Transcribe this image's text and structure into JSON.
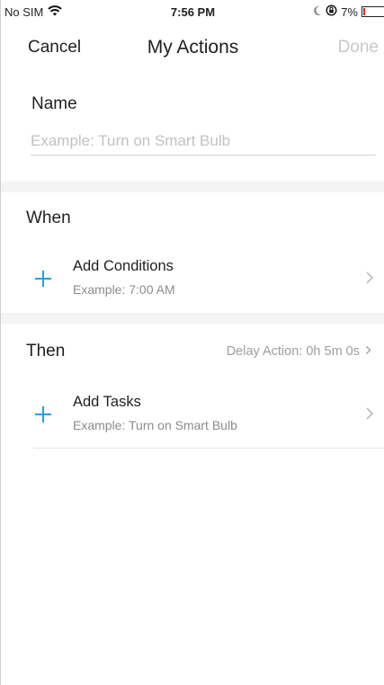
{
  "status_bar": {
    "carrier": "No SIM",
    "time": "7:56 PM",
    "battery": "7%",
    "battery_level_percent": 7,
    "icons": [
      "wifi-icon",
      "moon-icon",
      "rotation-lock-icon",
      "battery-icon"
    ]
  },
  "nav": {
    "cancel": "Cancel",
    "title": "My Actions",
    "done": "Done"
  },
  "name": {
    "label": "Name",
    "placeholder": "Example: Turn on Smart Bulb",
    "value": ""
  },
  "when": {
    "title": "When",
    "row_title": "Add Conditions",
    "row_subtitle": "Example: 7:00 AM"
  },
  "then": {
    "title": "Then",
    "delay": "Delay Action: 0h 5m 0s",
    "row_title": "Add Tasks",
    "row_subtitle": "Example: Turn on Smart Bulb"
  },
  "colors": {
    "accent": "#2a9be0",
    "done_disabled": "#c8c8c8",
    "separator": "#f4f4f4",
    "battery_low": "#e0271d"
  }
}
